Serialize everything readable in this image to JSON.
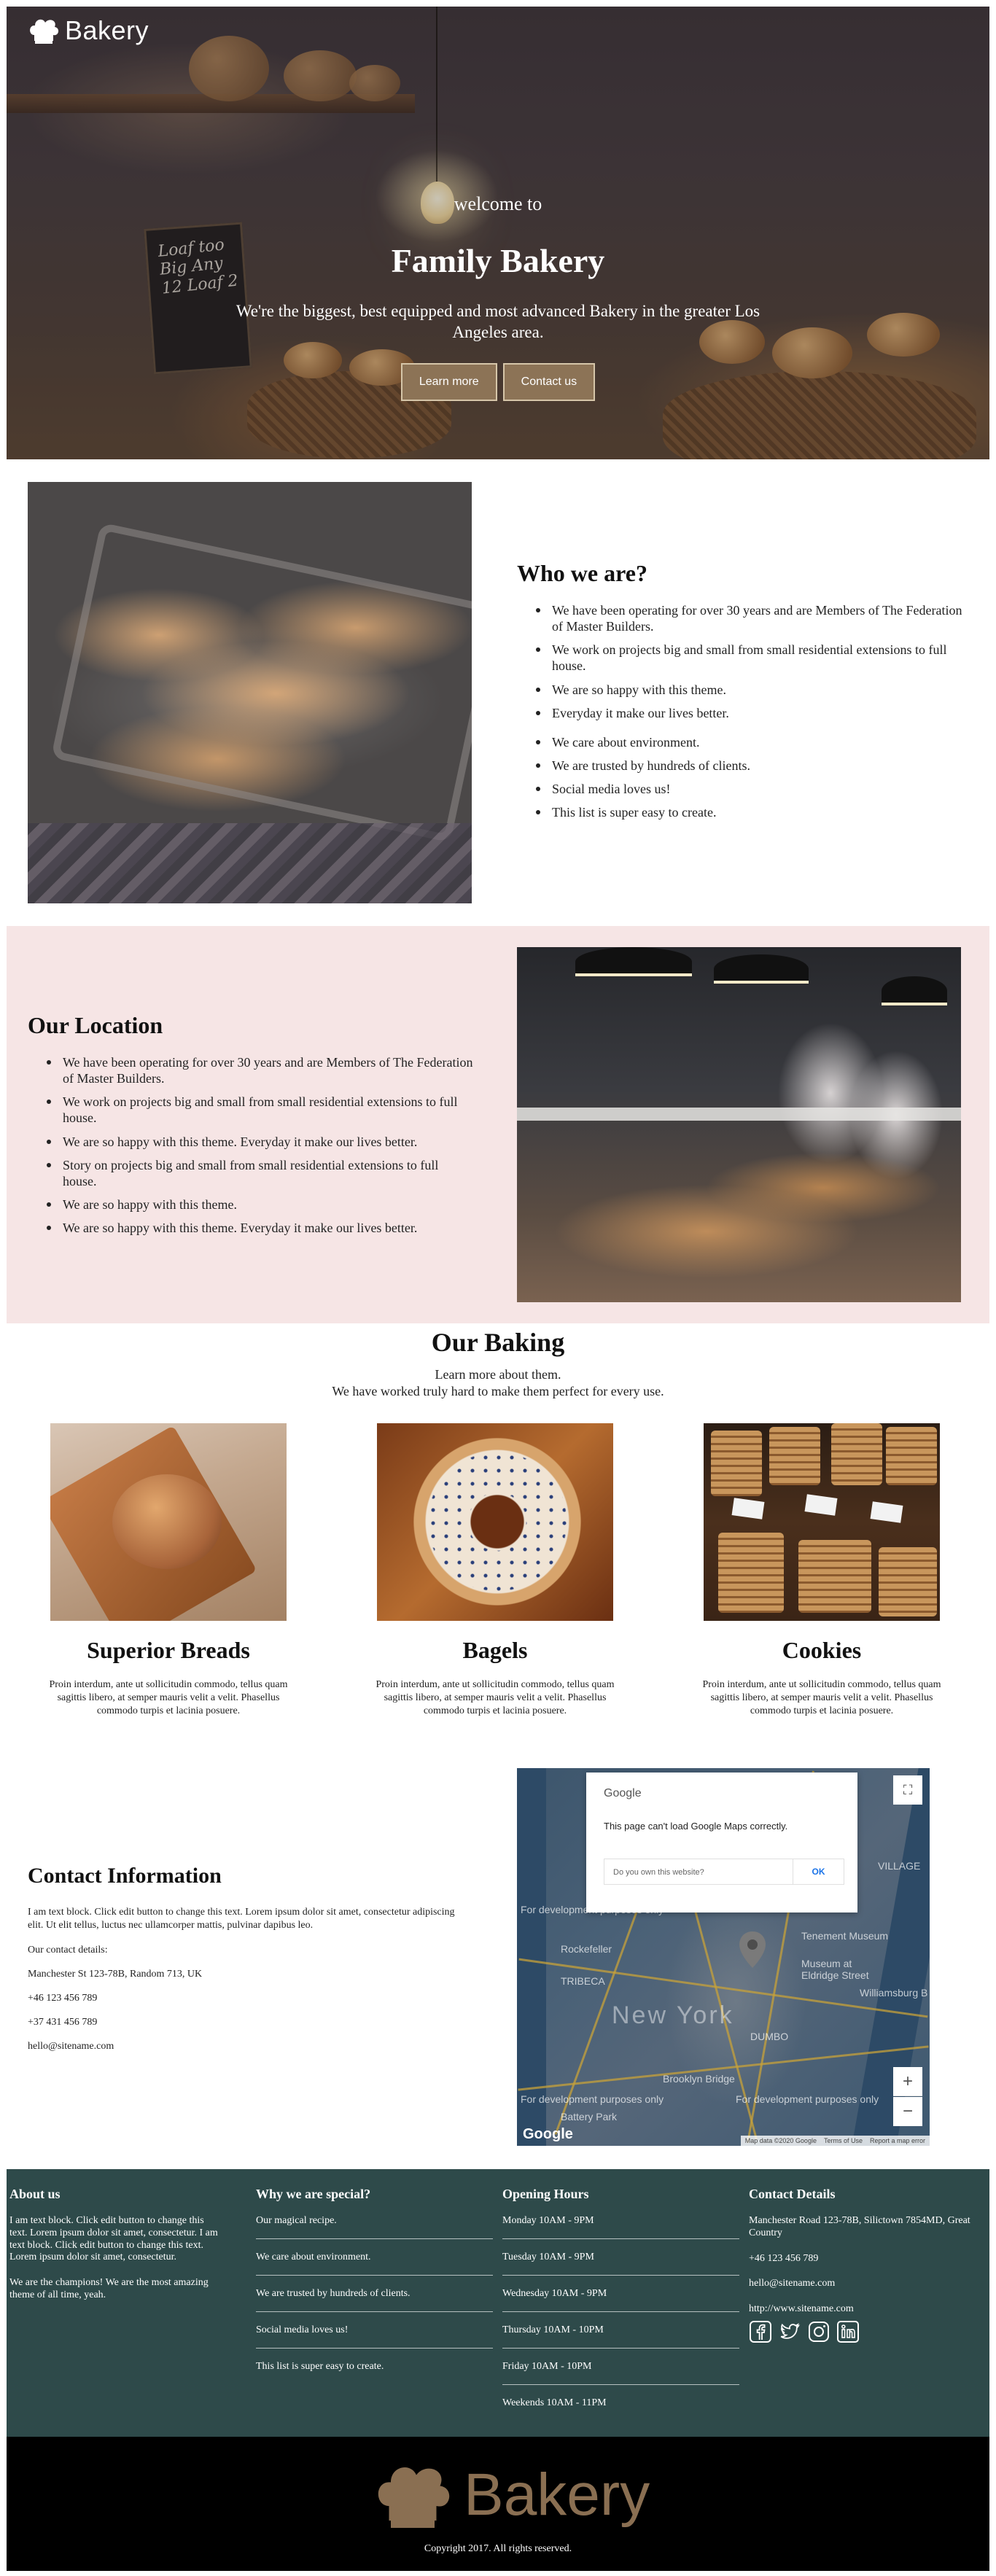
{
  "brand": {
    "name": "Bakery"
  },
  "hero": {
    "welcome": "welcome to",
    "title": "Family Bakery",
    "subtitle": "We're the biggest, best equipped and most advanced Bakery in the greater Los Angeles area.",
    "buttons": {
      "learn_more": "Learn more",
      "contact": "Contact us"
    },
    "chalkboard": "Loaf too Big Any 12 Loaf 2"
  },
  "who": {
    "title": "Who we are?",
    "items": [
      "We have been operating for over 30 years and are Members of The Federation of Master Builders.",
      "We work on projects big and small from small residential extensions to full house.",
      "We are so happy with this theme.",
      "Everyday it make our lives better.",
      "We care about environment.",
      "We are trusted by hundreds of clients.",
      "Social media loves us!",
      "This list is super easy to create."
    ]
  },
  "location": {
    "title": "Our Location",
    "items": [
      "We have been operating for over 30 years and are Members of The Federation of Master Builders.",
      "We work on projects big and small from small residential extensions to full house.",
      "We are so happy with this theme. Everyday it make our lives better.",
      "Story on projects big and small from small residential extensions to full house.",
      "We are so happy with this theme.",
      "We are so happy with this theme. Everyday it make our lives better."
    ]
  },
  "baking": {
    "title": "Our Baking",
    "subtitle_line1": "Learn more about them.",
    "subtitle_line2": "We have worked truly hard to make them perfect for every use.",
    "products": [
      {
        "name": "Superior Breads",
        "desc": "Proin interdum, ante ut sollicitudin commodo, tellus quam sagittis libero, at semper mauris velit a velit. Phasellus commodo turpis et lacinia posuere."
      },
      {
        "name": "Bagels",
        "desc": "Proin interdum, ante ut sollicitudin commodo, tellus quam sagittis libero, at semper mauris velit a velit. Phasellus commodo turpis et lacinia posuere."
      },
      {
        "name": "Cookies",
        "desc": "Proin interdum, ante ut sollicitudin commodo, tellus quam sagittis libero, at semper mauris velit a velit. Phasellus commodo turpis et lacinia posuere."
      }
    ]
  },
  "contact": {
    "title": "Contact Information",
    "text": "I am text block. Click edit button to change this text. Lorem ipsum dolor sit amet, consectetur adipiscing elit. Ut elit tellus, luctus nec ullamcorper mattis, pulvinar dapibus leo.",
    "details_label": "Our contact details:",
    "address": "Manchester St 123-78B, Random 713, UK",
    "phone1": "+46 123 456 789",
    "phone2": "+37 431 456 789",
    "email": "hello@sitename.com"
  },
  "map": {
    "provider": "Google",
    "error": "This page can't load Google Maps correctly.",
    "own_question": "Do you own this website?",
    "ok": "OK",
    "city": "New York",
    "dev_label": "For development purposes only",
    "labels": [
      "TRIBECA",
      "VILLAGE",
      "Tenement Museum",
      "Museum at Eldridge Street",
      "Williamsburg B",
      "Rockefeller",
      "Brooklyn Bridge",
      "Battery Park",
      "DUMBO"
    ],
    "attribution": [
      "Map data ©2020 Google",
      "Terms of Use",
      "Report a map error"
    ],
    "zoom_in": "+",
    "zoom_out": "−",
    "fullscreen": "⛶"
  },
  "footer": {
    "about": {
      "title": "About us",
      "text1": "I am text block. Click edit button to change this text. Lorem ipsum dolor sit amet, consectetur. I am text block. Click edit button to change this text. Lorem ipsum dolor sit amet, consectetur.",
      "text2": "We are the champions! We are the most amazing theme of all time, yeah."
    },
    "special": {
      "title": "Why we are special?",
      "items": [
        "Our magical recipe.",
        "We care about environment.",
        "We are trusted by hundreds of clients.",
        "Social media loves us!",
        "This list is super easy to create."
      ]
    },
    "hours": {
      "title": "Opening Hours",
      "items": [
        "Monday 10AM - 9PM",
        "Tuesday 10AM - 9PM",
        "Wednesday 10AM - 9PM",
        "Thursday 10AM - 10PM",
        "Friday 10AM - 10PM",
        "Weekends 10AM - 11PM"
      ]
    },
    "details": {
      "title": "Contact Details",
      "address": "Manchester Road 123-78B, Silictown 7854MD, Great Country",
      "phone": "+46 123 456 789",
      "email": "hello@sitename.com",
      "web": "http://www.sitename.com",
      "social": [
        "facebook-icon",
        "twitter-icon",
        "instagram-icon",
        "linkedin-icon"
      ]
    }
  },
  "bottom": {
    "logo_text": "Bakery",
    "copyright": "Copyright 2017. All rights reserved."
  },
  "colors": {
    "accent_button": "#8c7356",
    "location_band": "#f6e5e5",
    "footer_bg": "#2e4a4a",
    "logo_brown": "#8a6f52"
  }
}
